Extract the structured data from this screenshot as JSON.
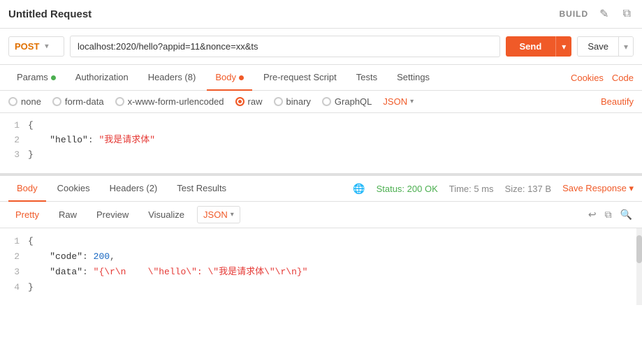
{
  "header": {
    "title": "Untitled Request",
    "build_label": "BUILD"
  },
  "url_bar": {
    "method": "POST",
    "url": "localhost:2020/hello?appid=11&nonce=xx&ts",
    "send_label": "Send",
    "save_label": "Save"
  },
  "tabs": {
    "items": [
      {
        "id": "params",
        "label": "Params",
        "dot": "green"
      },
      {
        "id": "authorization",
        "label": "Authorization",
        "dot": null
      },
      {
        "id": "headers",
        "label": "Headers (8)",
        "dot": null
      },
      {
        "id": "body",
        "label": "Body",
        "dot": "orange",
        "active": true
      },
      {
        "id": "prerequest",
        "label": "Pre-request Script",
        "dot": null
      },
      {
        "id": "tests",
        "label": "Tests",
        "dot": null
      },
      {
        "id": "settings",
        "label": "Settings",
        "dot": null
      }
    ],
    "right_links": [
      "Cookies",
      "Code"
    ]
  },
  "body_type": {
    "options": [
      {
        "id": "none",
        "label": "none"
      },
      {
        "id": "form-data",
        "label": "form-data"
      },
      {
        "id": "urlencoded",
        "label": "x-www-form-urlencoded"
      },
      {
        "id": "raw",
        "label": "raw",
        "selected": true
      },
      {
        "id": "binary",
        "label": "binary"
      },
      {
        "id": "graphql",
        "label": "GraphQL"
      }
    ],
    "format": "JSON",
    "beautify_label": "Beautify"
  },
  "request_body": {
    "lines": [
      {
        "num": "1",
        "content": "{"
      },
      {
        "num": "2",
        "content": "    \"hello\": \"我是请求体\""
      },
      {
        "num": "3",
        "content": "}"
      }
    ]
  },
  "response": {
    "tabs": [
      "Body",
      "Cookies",
      "Headers (2)",
      "Test Results"
    ],
    "active_tab": "Body",
    "status": "Status: 200 OK",
    "time": "Time: 5 ms",
    "size": "Size: 137 B",
    "save_response_label": "Save Response",
    "inner_tabs": [
      "Pretty",
      "Raw",
      "Preview",
      "Visualize"
    ],
    "active_inner_tab": "Pretty",
    "format": "JSON",
    "lines": [
      {
        "num": "1",
        "content": "{"
      },
      {
        "num": "2",
        "content": "    \"code\": 200,"
      },
      {
        "num": "3",
        "content": "    \"data\": \"{\\r\\n    \\\"hello\\\": \\\"我是请求体\\\"\\r\\n}\""
      },
      {
        "num": "4",
        "content": "}"
      }
    ]
  },
  "icons": {
    "edit": "✏️",
    "copy": "⧉",
    "chevron_down": "▾",
    "globe": "🌐",
    "wrap": "↩"
  }
}
